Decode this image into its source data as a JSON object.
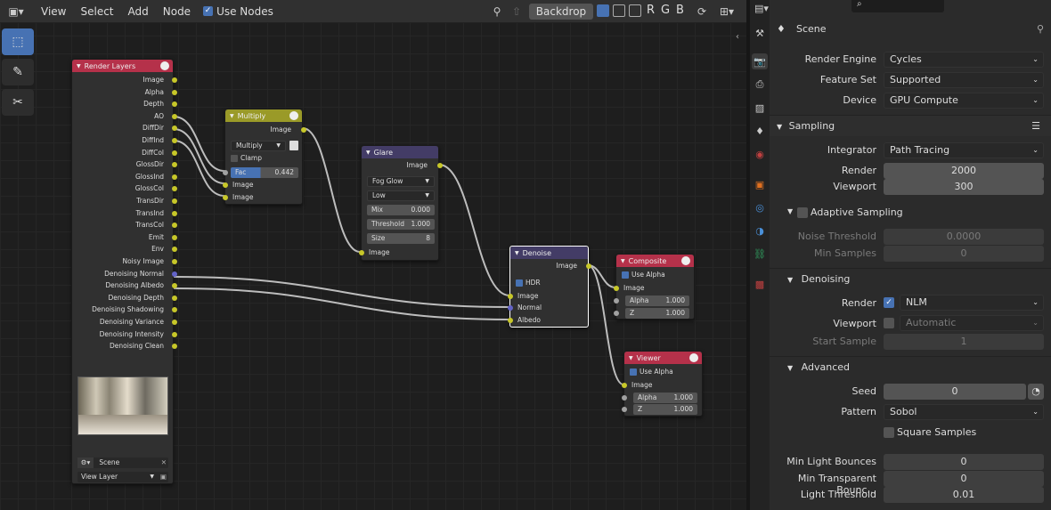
{
  "header": {
    "menus": [
      "View",
      "Select",
      "Add",
      "Node"
    ],
    "use_nodes_label": "Use Nodes",
    "backdrop_label": "Backdrop",
    "channels": [
      "R",
      "G",
      "B"
    ]
  },
  "nodes": {
    "render_layers": {
      "title": "Render Layers",
      "outputs": [
        "Image",
        "Alpha",
        "Depth",
        "AO",
        "DiffDir",
        "DiffInd",
        "DiffCol",
        "GlossDir",
        "GlossInd",
        "GlossCol",
        "TransDir",
        "TransInd",
        "TransCol",
        "Emit",
        "Env",
        "Noisy Image",
        "Denoising Normal",
        "Denoising Albedo",
        "Denoising Depth",
        "Denoising Shadowing",
        "Denoising Variance",
        "Denoising Intensity",
        "Denoising Clean"
      ],
      "scene": "Scene",
      "view_layer": "View Layer"
    },
    "multiply": {
      "title": "Multiply",
      "output": "Image",
      "blend": "Multiply",
      "clamp": "Clamp",
      "fac_label": "Fac",
      "fac_value": "0.442",
      "input1": "Image",
      "input2": "Image"
    },
    "glare": {
      "title": "Glare",
      "output": "Image",
      "type": "Fog Glow",
      "quality": "Low",
      "mix_label": "Mix",
      "mix_value": "0.000",
      "threshold_label": "Threshold",
      "threshold_value": "1.000",
      "size_label": "Size",
      "size_value": "8",
      "input": "Image"
    },
    "denoise": {
      "title": "Denoise",
      "output": "Image",
      "hdr": "HDR",
      "in_image": "Image",
      "in_normal": "Normal",
      "in_albedo": "Albedo"
    },
    "composite": {
      "title": "Composite",
      "use_alpha": "Use Alpha",
      "in_image": "Image",
      "alpha_label": "Alpha",
      "alpha_value": "1.000",
      "z_label": "Z",
      "z_value": "1.000"
    },
    "viewer": {
      "title": "Viewer",
      "use_alpha": "Use Alpha",
      "in_image": "Image",
      "alpha_label": "Alpha",
      "alpha_value": "1.000",
      "z_label": "Z",
      "z_value": "1.000"
    }
  },
  "properties": {
    "context": "Scene",
    "render_engine_label": "Render Engine",
    "render_engine": "Cycles",
    "feature_set_label": "Feature Set",
    "feature_set": "Supported",
    "device_label": "Device",
    "device": "GPU Compute",
    "sampling": {
      "title": "Sampling",
      "integrator_label": "Integrator",
      "integrator": "Path Tracing",
      "render_label": "Render",
      "render": "2000",
      "viewport_label": "Viewport",
      "viewport": "300",
      "adaptive_title": "Adaptive Sampling",
      "noise_threshold_label": "Noise Threshold",
      "noise_threshold": "0.0000",
      "min_samples_label": "Min Samples",
      "min_samples": "0"
    },
    "denoising": {
      "title": "Denoising",
      "render_label": "Render",
      "render": "NLM",
      "viewport_label": "Viewport",
      "viewport": "Automatic",
      "start_sample_label": "Start Sample",
      "start_sample": "1"
    },
    "advanced": {
      "title": "Advanced",
      "seed_label": "Seed",
      "seed": "0",
      "pattern_label": "Pattern",
      "pattern": "Sobol",
      "square_samples": "Square Samples",
      "min_light_label": "Min Light Bounces",
      "min_light": "0",
      "min_trans_label": "Min Transparent Bounc...",
      "min_trans": "0",
      "light_threshold_label": "Light Threshold",
      "light_threshold": "0.01"
    }
  },
  "colors": {
    "accent": "#4772b3",
    "input_node": "#b5314a",
    "color_node": "#9a9a28",
    "filter_node": "#433c66",
    "output_node": "#b5314a",
    "socket_color": "#c7c729",
    "socket_value": "#a1a1a1",
    "socket_vector": "#6363c7"
  }
}
